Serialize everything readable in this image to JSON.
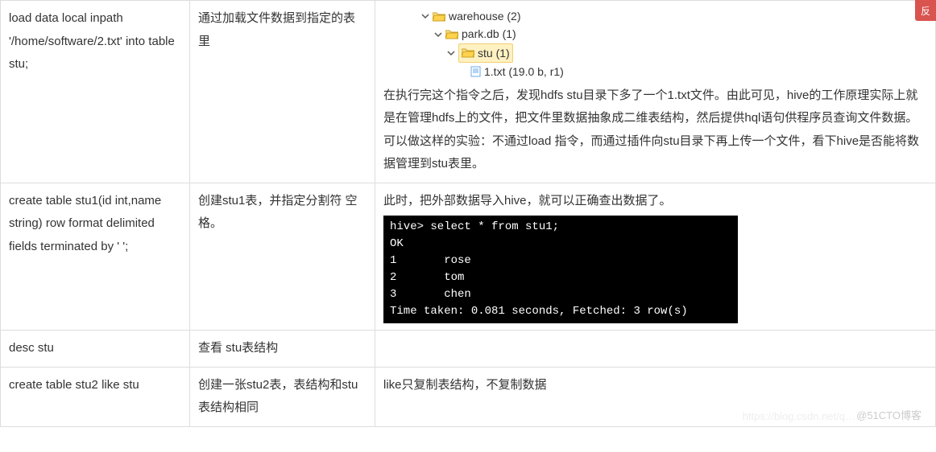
{
  "rows": [
    {
      "cmd": "load data local inpath '/home/software/2.txt' into table stu;",
      "desc": "通过加载文件数据到指定的表里",
      "tree": {
        "l0": "warehouse (2)",
        "l1": "park.db (1)",
        "l2": "stu (1)",
        "l3": "1.txt (19.0 b, r1)"
      },
      "p1": "在执行完这个指令之后，发现hdfs stu目录下多了一个1.txt文件。由此可见，hive的工作原理实际上就是在管理hdfs上的文件，把文件里数据抽象成二维表结构，然后提供hql语句供程序员查询文件数据。",
      "p2": "可以做这样的实验：不通过load 指令，而通过插件向stu目录下再上传一个文件，看下hive是否能将数据管理到stu表里。"
    },
    {
      "cmd": "create table stu1(id int,name string) row format delimited fields terminated by '  ';",
      "desc": "创建stu1表，并指定分割符 空格。",
      "intro": "此时，把外部数据导入hive，就可以正确查出数据了。",
      "term": "hive> select * from stu1;\nOK\n1       rose\n2       tom\n3       chen\nTime taken: 0.081 seconds, Fetched: 3 row(s)"
    },
    {
      "cmd": "desc  stu",
      "desc": "查看 stu表结构"
    },
    {
      "cmd": "create table stu2 like stu",
      "desc": "创建一张stu2表，表结构和stu表结构相同",
      "note": "like只复制表结构，不复制数据"
    }
  ],
  "watermark": "@51CTO博客",
  "watermark2": "https://blog.csdn.net/q…",
  "badge": "反"
}
